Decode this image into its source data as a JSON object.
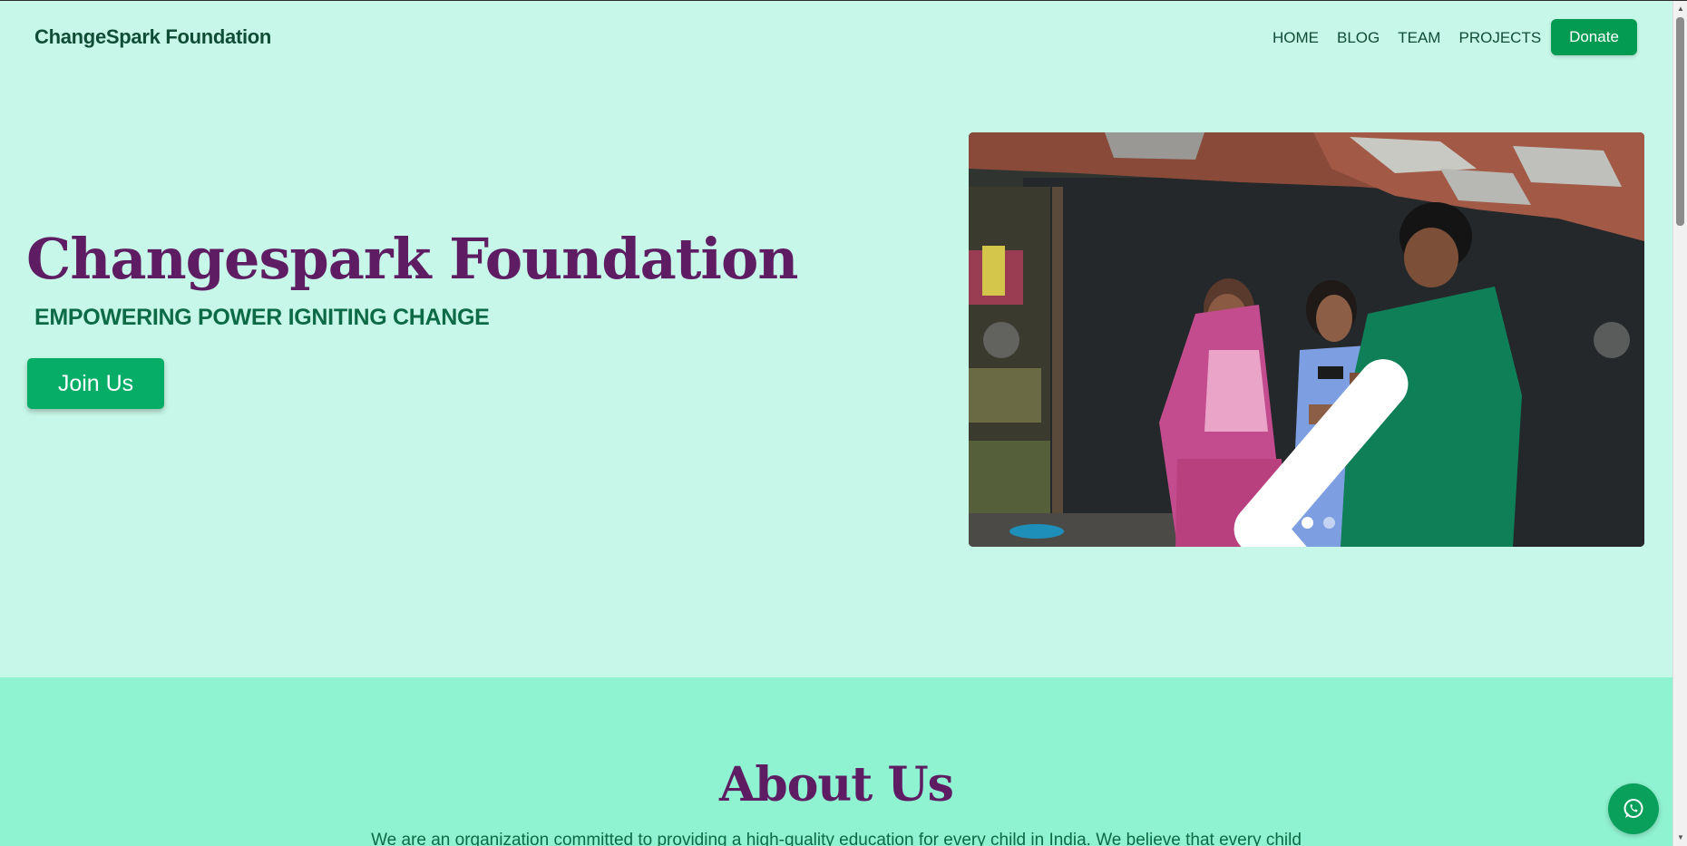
{
  "nav": {
    "brand": "ChangeSpark Foundation",
    "links": [
      "HOME",
      "BLOG",
      "TEAM",
      "PROJECTS"
    ],
    "donate_label": "Donate"
  },
  "hero": {
    "title": "Changespark Foundation",
    "subtitle": "EMPOWERING POWER IGNITING CHANGE",
    "cta_label": "Join Us"
  },
  "carousel": {
    "slide_count": 3,
    "active_index": 1,
    "prev_icon": "chevron-left-icon",
    "next_icon": "chevron-right-icon"
  },
  "about": {
    "title": "About Us",
    "text": "We are an organization committed to providing a high-quality education for every child in India. We believe that every child"
  },
  "fab": {
    "icon": "whatsapp-icon"
  },
  "colors": {
    "page_bg": "#c7f7e8",
    "about_bg": "#8ff2d0",
    "accent": "#039b52",
    "title": "#5e1d63",
    "text": "#0f4d36"
  }
}
